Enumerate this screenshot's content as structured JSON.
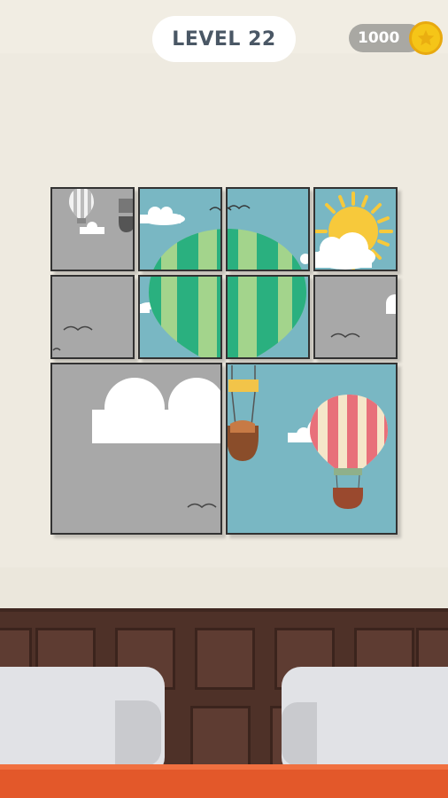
{
  "header": {
    "level_label": "LEVEL 22",
    "coins": "1000"
  },
  "icons": {
    "coin": "star-coin-icon",
    "sun": "sun-icon",
    "balloon": "hot-air-balloon-icon",
    "cloud": "cloud-icon",
    "bird": "bird-icon"
  },
  "puzzle": {
    "grid": "4x4",
    "piece_count": 10,
    "colors": {
      "sky": "#79b7c3",
      "gray_tile": "#a8a8a8",
      "tile_border": "#333333",
      "balloon_green": "#2bb07f",
      "balloon_light_green": "#a3d48c",
      "balloon_red": "#e8707a",
      "balloon_cream": "#f5e6c9",
      "sun": "#f7c93a"
    }
  },
  "scene": {
    "headboard_color": "#4e3128",
    "pillow_color": "#e1e2e6",
    "bed_color": "#e3582a"
  }
}
